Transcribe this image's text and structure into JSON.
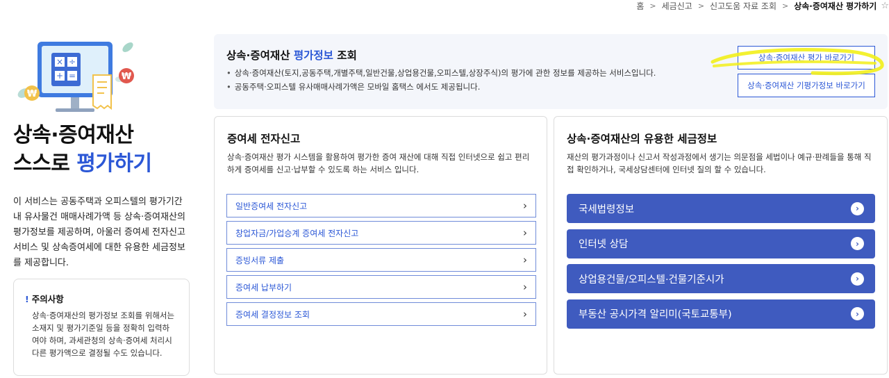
{
  "breadcrumb": {
    "items": [
      "홈",
      "세금신고",
      "신고도움 자료 조회"
    ],
    "current": "상속·증여재산 평가하기"
  },
  "hero": {
    "title_line1": "상속·증여재산",
    "title_line2_prefix": "스스로 ",
    "title_line2_accent": "평가하기",
    "intro": "이 서비스는 공동주택과 오피스텔의 평가기간 내 유사물건 매매사례가액 등 상속·증여재산의 평가정보를 제공하며, 아울러 증여세 전자신고 서비스 및 상속증여세에 대한 유용한 세금정보를 제공합니다."
  },
  "notice": {
    "mark": "!",
    "title": "주의사항",
    "text": "상속·증여재산의 평가정보 조회를 위해서는 소재지 및 평가기준일 등을 정확히 입력하여야 하며, 과세관청의 상속·증여세 처리시 다른 평가액으로 결정될 수도 있습니다."
  },
  "info": {
    "title_prefix": "상속·증여재산 ",
    "title_accent": "평가정보",
    "title_suffix": " 조회",
    "bullets": [
      "상속·증여재산(토지,공동주택,개별주택,일반건물,상업용건물,오피스텔,상장주식)의 평가에 관한 정보를 제공하는 서비스입니다.",
      "공동주택·오피스텔 유사매매사례가액은 모바일 홈택스 에서도 제공됩니다."
    ],
    "btn_eval": "상속·증여재산 평가 바로가기",
    "btn_prev": "상속·증여재산 기평가정보 바로가기"
  },
  "efile": {
    "title": "증여세 전자신고",
    "desc": "상속·증여재산 평가 시스템을 활용하여 평가한 증여 재산에 대해 직접 인터넷으로 쉽고 편리하게 증여세를 신고·납부할 수 있도록 하는 서비스 입니다.",
    "items": [
      {
        "label": "일반증여세 전자신고"
      },
      {
        "label": "창업자금/가업승계 증여세 전자신고"
      },
      {
        "label": "증빙서류 제출"
      },
      {
        "label": "증여세 납부하기"
      },
      {
        "label": "증여세 결정정보 조회"
      }
    ]
  },
  "taxinfo": {
    "title": "상속·증여재산의 유용한 세금정보",
    "desc": "재산의 평가과정이나 신고서 작성과정에서 생기는 의문점을 세법이나 예규·판례들을 통해 직접 확인하거나, 국세상담센터에 인터넷 질의 할 수 있습니다.",
    "items": [
      {
        "label": "국세법령정보"
      },
      {
        "label": "인터넷 상담"
      },
      {
        "label": "상업용건물/오피스텔·건물기준시가"
      },
      {
        "label": "부동산 공시가격 알리미(국토교통부)"
      }
    ]
  },
  "colors": {
    "accent": "#2b57d6",
    "solid_button": "#3f5bbf",
    "info_bg": "#f4f6fb",
    "highlighter": "#f2ef1a"
  },
  "icons": {
    "breadcrumb_separator": "chevron-right-icon",
    "favorite": "star-icon",
    "outline_item": "chevron-right-icon",
    "solid_item": "circle-arrow-icon",
    "hero": "calculator-monitor-illustration"
  }
}
